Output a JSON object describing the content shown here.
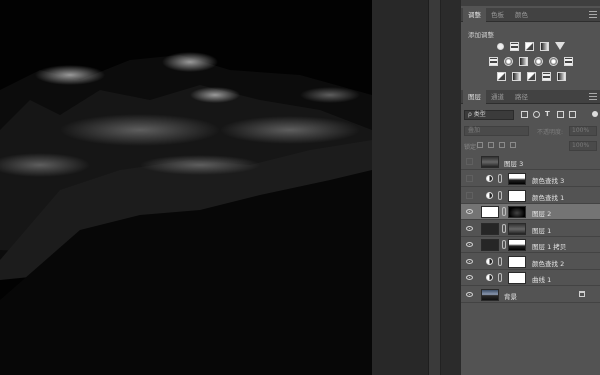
{
  "adjustments_panel": {
    "tabs": [
      {
        "label": "调整",
        "active": true
      },
      {
        "label": "色板",
        "active": false
      },
      {
        "label": "颜色",
        "active": false
      }
    ],
    "title": "添加调整",
    "row1": [
      "brightness-contrast-icon",
      "levels-icon",
      "curves-icon",
      "exposure-icon",
      "vibrance-icon"
    ],
    "row2": [
      "hue-saturation-icon",
      "color-balance-icon",
      "black-white-icon",
      "photo-filter-icon",
      "channel-mixer-icon",
      "color-lookup-icon"
    ],
    "row3": [
      "invert-icon",
      "posterize-icon",
      "threshold-icon",
      "selective-color-icon",
      "gradient-map-icon"
    ]
  },
  "layers_panel": {
    "tabs": [
      {
        "label": "图层",
        "active": true
      },
      {
        "label": "通道",
        "active": false
      },
      {
        "label": "路径",
        "active": false
      }
    ],
    "filter_kind": "ρ 类型",
    "blend_mode": "叠加",
    "opacity_label": "不透明度:",
    "opacity_value": "100%",
    "lock_label": "锁定:",
    "fill_value": "100%",
    "layers": [
      {
        "name": "图层 3",
        "visible": false,
        "type": "pixel",
        "thumb": "photo-dark",
        "selected": false
      },
      {
        "name": "颜色查找 3",
        "visible": false,
        "type": "adjustment",
        "thumb": "gradient",
        "selected": false
      },
      {
        "name": "颜色查找 1",
        "visible": false,
        "type": "adjustment",
        "thumb": "white",
        "selected": false
      },
      {
        "name": "图层 2",
        "visible": true,
        "type": "masked",
        "thumb": "white",
        "mask": "mask",
        "selected": true
      },
      {
        "name": "图层 1",
        "visible": true,
        "type": "masked",
        "thumb": "dark",
        "mask": "photo-dark",
        "selected": false
      },
      {
        "name": "图层 1 拷贝",
        "visible": true,
        "type": "masked",
        "thumb": "dark",
        "mask": "gradient",
        "selected": false
      },
      {
        "name": "颜色查找 2",
        "visible": true,
        "type": "adjustment",
        "thumb": "white",
        "selected": false
      },
      {
        "name": "曲线 1",
        "visible": true,
        "type": "adjustment",
        "thumb": "white",
        "selected": false
      },
      {
        "name": "背景",
        "visible": true,
        "type": "background",
        "thumb": "photo",
        "selected": false,
        "locked": true
      }
    ]
  }
}
